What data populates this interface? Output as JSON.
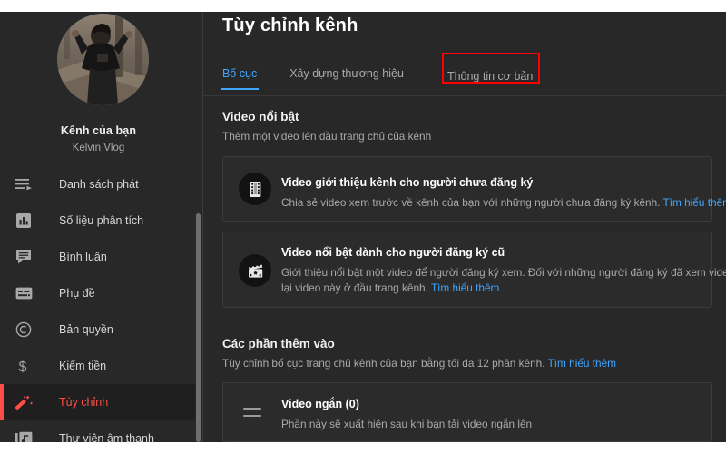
{
  "app": {
    "title": "Tùy chỉnh kênh",
    "accent_blue": "#3ea6ff",
    "accent_red": "#ff4e45",
    "highlight_red": "#ff0000",
    "background": "#282828"
  },
  "sidebar": {
    "channel": {
      "name": "Kênh của bạn",
      "subtitle": "Kelvin Vlog",
      "avatar_alt": "avatar"
    },
    "items": [
      {
        "label": "Danh sách phát",
        "icon": "playlist-icon",
        "active": false
      },
      {
        "label": "Số liệu phân tích",
        "icon": "analytics-icon",
        "active": false
      },
      {
        "label": "Bình luận",
        "icon": "comments-icon",
        "active": false
      },
      {
        "label": "Phụ đề",
        "icon": "subtitles-icon",
        "active": false
      },
      {
        "label": "Bản quyền",
        "icon": "copyright-icon",
        "active": false
      },
      {
        "label": "Kiếm tiền",
        "icon": "dollar-icon",
        "active": false
      },
      {
        "label": "Tùy chỉnh",
        "icon": "magic-wand-icon",
        "active": true
      },
      {
        "label": "Thư viện âm thanh",
        "icon": "audio-library-icon",
        "active": false
      }
    ]
  },
  "tabs": [
    {
      "label": "Bố cục",
      "active": true,
      "highlighted": false
    },
    {
      "label": "Xây dựng thương hiệu",
      "active": false,
      "highlighted": false
    },
    {
      "label": "Thông tin cơ bản",
      "active": false,
      "highlighted": true
    }
  ],
  "sections": {
    "featured": {
      "title": "Video nổi bật",
      "description": "Thêm một video lên đầu trang chủ của kênh",
      "cards": [
        {
          "icon": "film-strip-icon",
          "title": "Video giới thiệu kênh cho người chưa đăng ký",
          "body": "Chia sẻ video xem trước về kênh của bạn với những người chưa đăng ký kênh.",
          "link": "Tìm hiểu thêm"
        },
        {
          "icon": "clapperboard-star-icon",
          "title": "Video nổi bật dành cho người đăng ký cũ",
          "body_line1": "Giới thiệu nổi bật một video để người đăng ký xem. Đối với những người đăng ký đã xem video bạn",
          "body_line2": "lại video này ở đầu trang kênh.",
          "link": "Tìm hiểu thêm"
        }
      ]
    },
    "added": {
      "title": "Các phần thêm vào",
      "description": "Tùy chỉnh bố cục trang chủ kênh của bạn bằng tối đa 12 phần kênh.",
      "description_link": "Tìm hiểu thêm",
      "rows": [
        {
          "icon": "drag-handle-icon",
          "title": "Video ngắn (0)",
          "body": "Phần này sẽ xuất hiện sau khi bạn tải video ngắn lên"
        }
      ]
    }
  }
}
